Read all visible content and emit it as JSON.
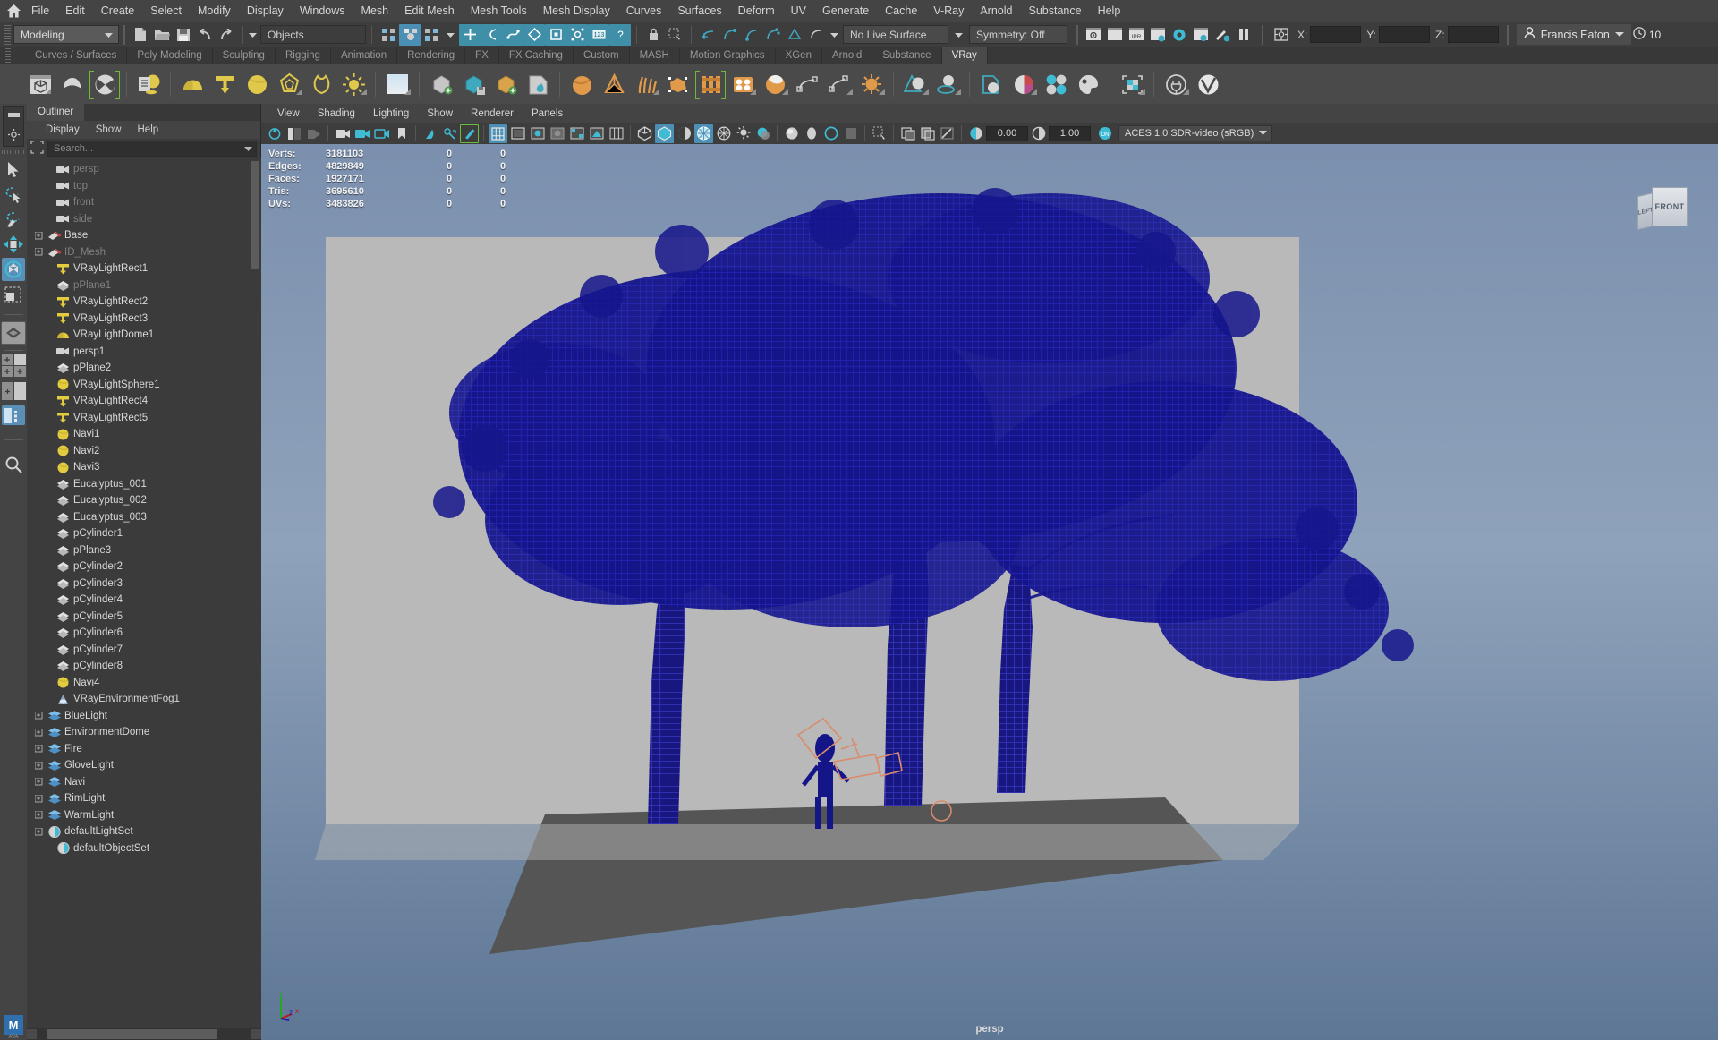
{
  "menubar": {
    "home_icon": "maya-home-icon",
    "items": [
      "File",
      "Edit",
      "Create",
      "Select",
      "Modify",
      "Display",
      "Windows",
      "Mesh",
      "Edit Mesh",
      "Mesh Tools",
      "Mesh Display",
      "Curves",
      "Surfaces",
      "Deform",
      "UV",
      "Generate",
      "Cache",
      "V-Ray",
      "Arnold",
      "Substance",
      "Help"
    ]
  },
  "statusline": {
    "mode_menu": "Modeling",
    "selection_mask": "Objects",
    "live_surface": "No Live Surface",
    "symmetry": "Symmetry: Off",
    "coord_labels": [
      "X:",
      "Y:",
      "Z:"
    ],
    "coord_values": [
      "",
      "",
      ""
    ],
    "user_name": "Francis Eaton",
    "user_icon": "person-icon",
    "clock_icon": "clock-icon",
    "clock_value": "10",
    "icons": [
      "new-scene-icon",
      "open-scene-icon",
      "save-scene-icon",
      "undo-icon",
      "redo-icon",
      "select-by-hierarchy-icon",
      "select-by-object-icon",
      "select-by-component-icon",
      "mask-handles-icon",
      "mask-curves-icon",
      "mask-surfaces-icon",
      "mask-deformations-icon",
      "mask-dynamics-icon",
      "mask-rendering-icon",
      "mask-misc-icon",
      "mask-help-icon",
      "lock-icon",
      "highlight-icon",
      "snap-grid-icon",
      "snap-curve-icon",
      "snap-point-icon",
      "snap-projected-icon",
      "snap-view-plane-icon",
      "snap-pivot-icon",
      "render-current-frame-icon",
      "render-sequence-icon",
      "ipr-render-icon",
      "render-settings-icon",
      "hypershade-icon",
      "render-view-icon",
      "render-setup-icon",
      "pause-icon",
      "attribute-editor-icon"
    ]
  },
  "shelf": {
    "tabs": [
      "Curves / Surfaces",
      "Poly Modeling",
      "Sculpting",
      "Rigging",
      "Animation",
      "Rendering",
      "FX",
      "FX Caching",
      "Custom",
      "MASH",
      "Motion Graphics",
      "XGen",
      "Arnold",
      "Substance",
      "VRay"
    ],
    "active_tab": "VRay",
    "icons": [
      "vray-frame-buffer-icon",
      "vray-render-icon",
      "vray-ipr-render-icon",
      "vray-render-settings-icon",
      "vray-dome-light-icon",
      "vray-rect-light-icon",
      "vray-sphere-light-icon",
      "vray-mesh-light-icon",
      "vray-ies-light-icon",
      "vray-sun-icon",
      "vray-sky-icon",
      "vray-proxy-create-icon",
      "vray-proxy-export-icon",
      "vray-proxy-import-icon",
      "vray-volume-grid-icon",
      "vray-fur-icon",
      "vray-displacement-icon",
      "vray-hair-icon",
      "vray-clipper-icon",
      "vray-mesh-material-icon",
      "vray-object-properties-icon",
      "vray-sphere-fade-icon",
      "vray-curve-icon",
      "vray-scatter-icon",
      "vray-object-settings-icon",
      "vray-material-icon",
      "vray-material-preview-icon",
      "vray-material-presets-icon",
      "vray-multi-material-icon",
      "vray-swatch-icon",
      "vray-color-picker-icon",
      "vray-uv-tools-icon",
      "vray-plugin-icon",
      "vray-logo-icon"
    ]
  },
  "toolbox": {
    "icons": [
      "select-tool-icon",
      "lasso-select-tool-icon",
      "paint-select-tool-icon",
      "move-tool-icon",
      "rotate-tool-icon",
      "scale-tool-icon",
      "last-tool-icon",
      "single-pane-layout-icon",
      "four-pane-layout-icon",
      "two-pane-layout-icon",
      "outliner-persp-layout-icon",
      "search-icon"
    ],
    "active": "rotate-tool-icon"
  },
  "outliner": {
    "tab_label": "Outliner",
    "menu": [
      "Display",
      "Show",
      "Help"
    ],
    "search_icon": "outliner-filter-icon",
    "search_placeholder": "Search...",
    "dropdown_icon": "chevron-down-icon",
    "items": [
      {
        "label": "persp",
        "icon": "camera-icon",
        "indent": 1,
        "expand": false,
        "dim": true
      },
      {
        "label": "top",
        "icon": "camera-icon",
        "indent": 1,
        "expand": false,
        "dim": true
      },
      {
        "label": "front",
        "icon": "camera-icon",
        "indent": 1,
        "expand": false,
        "dim": true
      },
      {
        "label": "side",
        "icon": "camera-icon",
        "indent": 1,
        "expand": false,
        "dim": true
      },
      {
        "label": "Base",
        "icon": "group-icon",
        "indent": 0,
        "expand": true,
        "dim": false
      },
      {
        "label": "ID_Mesh",
        "icon": "group-icon",
        "indent": 0,
        "expand": true,
        "dim": true
      },
      {
        "label": "VRayLightRect1",
        "icon": "rect-light-icon",
        "indent": 1,
        "expand": false,
        "dim": false
      },
      {
        "label": "pPlane1",
        "icon": "mesh-icon",
        "indent": 1,
        "expand": false,
        "dim": true
      },
      {
        "label": "VRayLightRect2",
        "icon": "rect-light-icon",
        "indent": 1,
        "expand": false,
        "dim": false
      },
      {
        "label": "VRayLightRect3",
        "icon": "rect-light-icon",
        "indent": 1,
        "expand": false,
        "dim": false
      },
      {
        "label": "VRayLightDome1",
        "icon": "dome-light-icon",
        "indent": 1,
        "expand": false,
        "dim": false
      },
      {
        "label": "persp1",
        "icon": "camera-icon",
        "indent": 1,
        "expand": false,
        "dim": false
      },
      {
        "label": "pPlane2",
        "icon": "mesh-icon",
        "indent": 1,
        "expand": false,
        "dim": false
      },
      {
        "label": "VRayLightSphere1",
        "icon": "sphere-light-icon",
        "indent": 1,
        "expand": false,
        "dim": false
      },
      {
        "label": "VRayLightRect4",
        "icon": "rect-light-icon",
        "indent": 1,
        "expand": false,
        "dim": false
      },
      {
        "label": "VRayLightRect5",
        "icon": "rect-light-icon",
        "indent": 1,
        "expand": false,
        "dim": false
      },
      {
        "label": "Navi1",
        "icon": "sphere-light-icon",
        "indent": 1,
        "expand": false,
        "dim": false
      },
      {
        "label": "Navi2",
        "icon": "sphere-light-icon",
        "indent": 1,
        "expand": false,
        "dim": false
      },
      {
        "label": "Navi3",
        "icon": "sphere-light-icon",
        "indent": 1,
        "expand": false,
        "dim": false
      },
      {
        "label": "Eucalyptus_001",
        "icon": "mesh-icon",
        "indent": 1,
        "expand": false,
        "dim": false
      },
      {
        "label": "Eucalyptus_002",
        "icon": "mesh-icon",
        "indent": 1,
        "expand": false,
        "dim": false
      },
      {
        "label": "Eucalyptus_003",
        "icon": "mesh-icon",
        "indent": 1,
        "expand": false,
        "dim": false
      },
      {
        "label": "pCylinder1",
        "icon": "mesh-icon",
        "indent": 1,
        "expand": false,
        "dim": false
      },
      {
        "label": "pPlane3",
        "icon": "mesh-icon",
        "indent": 1,
        "expand": false,
        "dim": false
      },
      {
        "label": "pCylinder2",
        "icon": "mesh-icon",
        "indent": 1,
        "expand": false,
        "dim": false
      },
      {
        "label": "pCylinder3",
        "icon": "mesh-icon",
        "indent": 1,
        "expand": false,
        "dim": false
      },
      {
        "label": "pCylinder4",
        "icon": "mesh-icon",
        "indent": 1,
        "expand": false,
        "dim": false
      },
      {
        "label": "pCylinder5",
        "icon": "mesh-icon",
        "indent": 1,
        "expand": false,
        "dim": false
      },
      {
        "label": "pCylinder6",
        "icon": "mesh-icon",
        "indent": 1,
        "expand": false,
        "dim": false
      },
      {
        "label": "pCylinder7",
        "icon": "mesh-icon",
        "indent": 1,
        "expand": false,
        "dim": false
      },
      {
        "label": "pCylinder8",
        "icon": "mesh-icon",
        "indent": 1,
        "expand": false,
        "dim": false
      },
      {
        "label": "Navi4",
        "icon": "sphere-light-icon",
        "indent": 1,
        "expand": false,
        "dim": false
      },
      {
        "label": "VRayEnvironmentFog1",
        "icon": "fog-icon",
        "indent": 1,
        "expand": false,
        "dim": false
      },
      {
        "label": "BlueLight",
        "icon": "layer-icon",
        "indent": 0,
        "expand": true,
        "dim": false
      },
      {
        "label": "EnvironmentDome",
        "icon": "layer-icon",
        "indent": 0,
        "expand": true,
        "dim": false
      },
      {
        "label": "Fire",
        "icon": "layer-icon",
        "indent": 0,
        "expand": true,
        "dim": false
      },
      {
        "label": "GloveLight",
        "icon": "layer-icon",
        "indent": 0,
        "expand": true,
        "dim": false
      },
      {
        "label": "Navi",
        "icon": "layer-icon",
        "indent": 0,
        "expand": true,
        "dim": false
      },
      {
        "label": "RimLight",
        "icon": "layer-icon",
        "indent": 0,
        "expand": true,
        "dim": false
      },
      {
        "label": "WarmLight",
        "icon": "layer-icon",
        "indent": 0,
        "expand": true,
        "dim": false
      },
      {
        "label": "defaultLightSet",
        "icon": "set-icon",
        "indent": 0,
        "expand": true,
        "dim": false
      },
      {
        "label": "defaultObjectSet",
        "icon": "set-icon",
        "indent": 1,
        "expand": false,
        "dim": false
      }
    ]
  },
  "viewport": {
    "menu": [
      "View",
      "Shading",
      "Lighting",
      "Show",
      "Renderer",
      "Panels"
    ],
    "exposure_icon": "exposure-icon",
    "exposure_value": "0.00",
    "gamma_icon": "gamma-icon",
    "gamma_value": "1.00",
    "color_mgmt_toggle": "color-management-on-icon",
    "color_space": "ACES 1.0 SDR-video (sRGB)",
    "color_space_arrow": "chevron-down-icon",
    "camera_label": "persp",
    "viewcube": {
      "front_face": "FRONT",
      "left_face": "LEFT"
    },
    "axis_gizmo": {
      "y": "y",
      "x": "x",
      "z": "z"
    },
    "heads_up": {
      "rows": [
        {
          "label": "Verts:",
          "total": "3181103",
          "c2": "0",
          "c3": "0"
        },
        {
          "label": "Edges:",
          "total": "4829849",
          "c2": "0",
          "c3": "0"
        },
        {
          "label": "Faces:",
          "total": "1927171",
          "c2": "0",
          "c3": "0"
        },
        {
          "label": "Tris:",
          "total": "3695610",
          "c2": "0",
          "c3": "0"
        },
        {
          "label": "UVs:",
          "total": "3483826",
          "c2": "0",
          "c3": "0"
        }
      ]
    },
    "tool_icons": [
      "select-camera-icon",
      "lock-camera-icon",
      "camera-attributes-icon",
      "bookmark-icon",
      "image-plane-icon",
      "two-d-pan-zoom-icon",
      "grease-pencil-icon",
      "grid-icon",
      "film-gate-icon",
      "resolution-gate-icon",
      "gate-mask-icon",
      "field-chart-icon",
      "safe-action-icon",
      "safe-title-icon",
      "wireframe-icon",
      "smooth-shade-all-icon",
      "shade-flat-icon",
      "use-all-lights-icon",
      "shadows-icon",
      "ambient-occlusion-icon",
      "motion-blur-icon",
      "multisample-icon",
      "depth-of-field-icon",
      "isolate-select-icon",
      "xray-icon",
      "xray-joints-icon"
    ]
  },
  "scene": {
    "object_color": "#1a1a8c",
    "ground_color": "#555555",
    "backdrop_color": "#b9b9b9",
    "sky_top": "#7b90ae",
    "sky_bottom": "#5e7795"
  },
  "app_logo": {
    "letter": "M",
    "sub": "AYA"
  }
}
